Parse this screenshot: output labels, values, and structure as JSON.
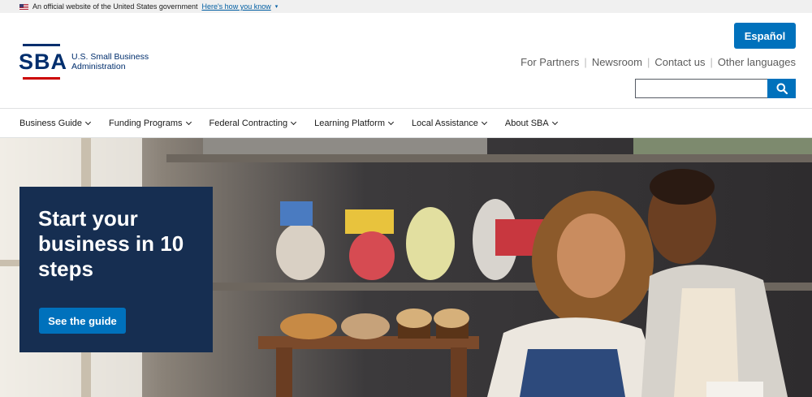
{
  "gov_banner": {
    "text": "An official website of the United States government",
    "link": "Here's how you know",
    "flag_icon": "us-flag-icon"
  },
  "header": {
    "logo_letters": "SBA",
    "logo_line1": "U.S. Small Business",
    "logo_line2": "Administration",
    "espanol_label": "Español",
    "util_links": [
      "For Partners",
      "Newsroom",
      "Contact us",
      "Other languages"
    ],
    "search_icon": "search-icon"
  },
  "nav": {
    "items": [
      "Business Guide",
      "Funding Programs",
      "Federal Contracting",
      "Learning Platform",
      "Local Assistance",
      "About SBA"
    ]
  },
  "hero": {
    "title": "Start your business in 10 steps",
    "button_label": "See the guide"
  },
  "colors": {
    "brand_navy": "#002e6d",
    "brand_red": "#cc0000",
    "primary_blue": "#0071bc",
    "callout_bg": "#162e51"
  }
}
